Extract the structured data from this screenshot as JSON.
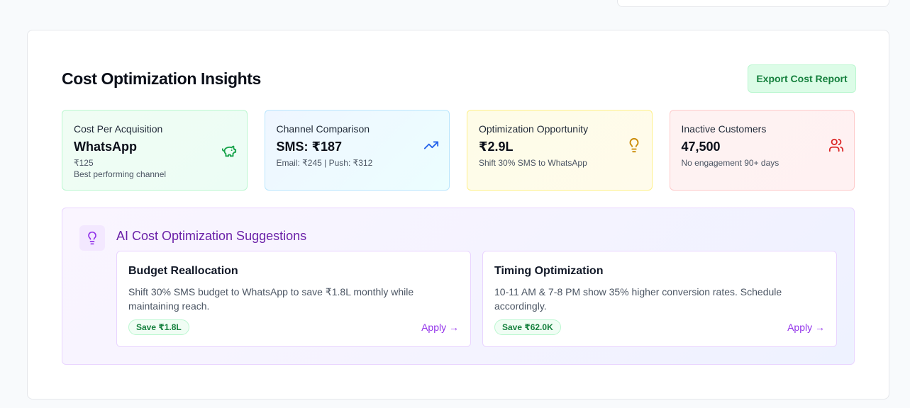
{
  "panel": {
    "title": "Cost Optimization Insights",
    "export_label": "Export Cost Report"
  },
  "stats": [
    {
      "label": "Cost Per Acquisition",
      "value": "WhatsApp",
      "sub": "₹125",
      "sub2": "Best performing channel",
      "icon": "piggy-bank-icon",
      "color": "#16a34a"
    },
    {
      "label": "Channel Comparison",
      "value": "SMS: ₹187",
      "sub": "Email: ₹245 | Push: ₹312",
      "icon": "trending-up-icon",
      "color": "#2563eb"
    },
    {
      "label": "Optimization Opportunity",
      "value": "₹2.9L",
      "sub": "Shift 30% SMS to WhatsApp",
      "icon": "lightbulb-icon",
      "color": "#ca8a04"
    },
    {
      "label": "Inactive Customers",
      "value": "47,500",
      "sub": "No engagement 90+ days",
      "icon": "users-icon",
      "color": "#dc2626"
    }
  ],
  "ai": {
    "title": "AI Cost Optimization Suggestions",
    "icon": "lightbulb-icon",
    "suggestions": [
      {
        "title": "Budget Reallocation",
        "desc": "Shift 30% SMS budget to WhatsApp to save ₹1.8L monthly while maintaining reach.",
        "save": "Save ₹1.8L",
        "apply": "Apply →"
      },
      {
        "title": "Timing Optimization",
        "desc": "10-11 AM & 7-8 PM show 35% higher conversion rates. Schedule accordingly.",
        "save": "Save ₹62.0K",
        "apply": "Apply →"
      }
    ]
  }
}
